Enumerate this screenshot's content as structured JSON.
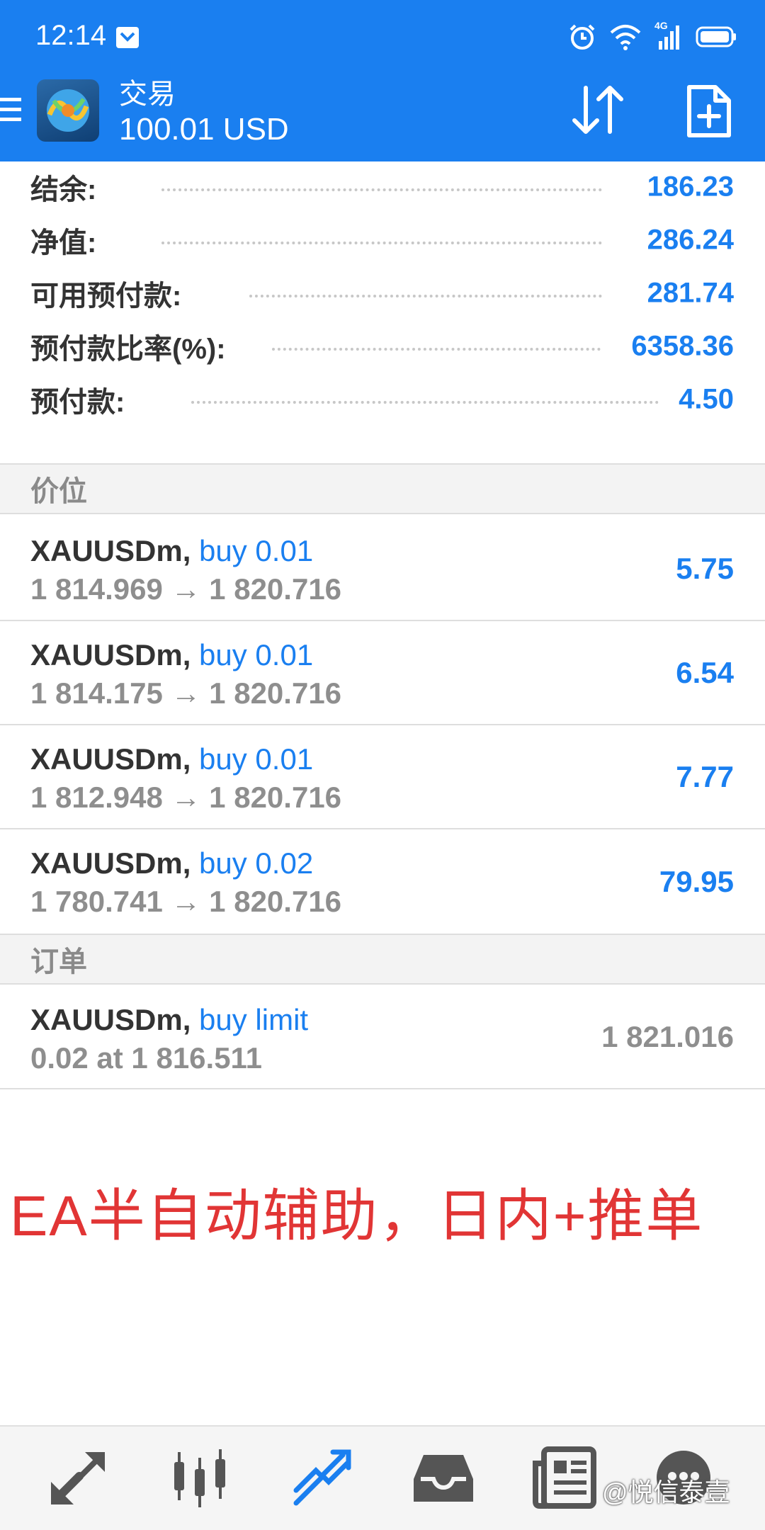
{
  "status_bar": {
    "time": "12:14",
    "network": "4G"
  },
  "app_bar": {
    "title": "交易",
    "subtitle": "100.01 USD"
  },
  "summary": [
    {
      "label": "结余:",
      "value": "186.23"
    },
    {
      "label": "净值:",
      "value": "286.24"
    },
    {
      "label": "可用预付款:",
      "value": "281.74"
    },
    {
      "label": "预付款比率(%):",
      "value": "6358.36"
    },
    {
      "label": "预付款:",
      "value": "4.50"
    }
  ],
  "positions_header": "价位",
  "positions": [
    {
      "symbol": "XAUUSDm,",
      "side": "buy 0.01",
      "prices": "1 814.969 → 1 820.716",
      "profit": "5.75"
    },
    {
      "symbol": "XAUUSDm,",
      "side": "buy 0.01",
      "prices": "1 814.175 → 1 820.716",
      "profit": "6.54"
    },
    {
      "symbol": "XAUUSDm,",
      "side": "buy 0.01",
      "prices": "1 812.948 → 1 820.716",
      "profit": "7.77"
    },
    {
      "symbol": "XAUUSDm,",
      "side": "buy 0.02",
      "prices": "1 780.741 → 1 820.716",
      "profit": "79.95"
    }
  ],
  "orders_header": "订单",
  "orders": [
    {
      "symbol": "XAUUSDm,",
      "side": "buy limit",
      "detail": "0.02 at 1 816.511",
      "price": "1 821.016"
    }
  ],
  "overlay_caption": "EA半自动辅助，日内+推单",
  "watermark": "@悦信泰壹",
  "bottom_nav": [
    {
      "icon": "quotes-arrows-icon",
      "active": false
    },
    {
      "icon": "chart-candles-icon",
      "active": false
    },
    {
      "icon": "trade-trend-icon",
      "active": true
    },
    {
      "icon": "history-inbox-icon",
      "active": false
    },
    {
      "icon": "news-icon",
      "active": false
    },
    {
      "icon": "messages-icon",
      "active": false
    }
  ],
  "colors": {
    "primary": "#1a7ff0",
    "caption": "#e13535",
    "muted": "#8e8e8e"
  }
}
